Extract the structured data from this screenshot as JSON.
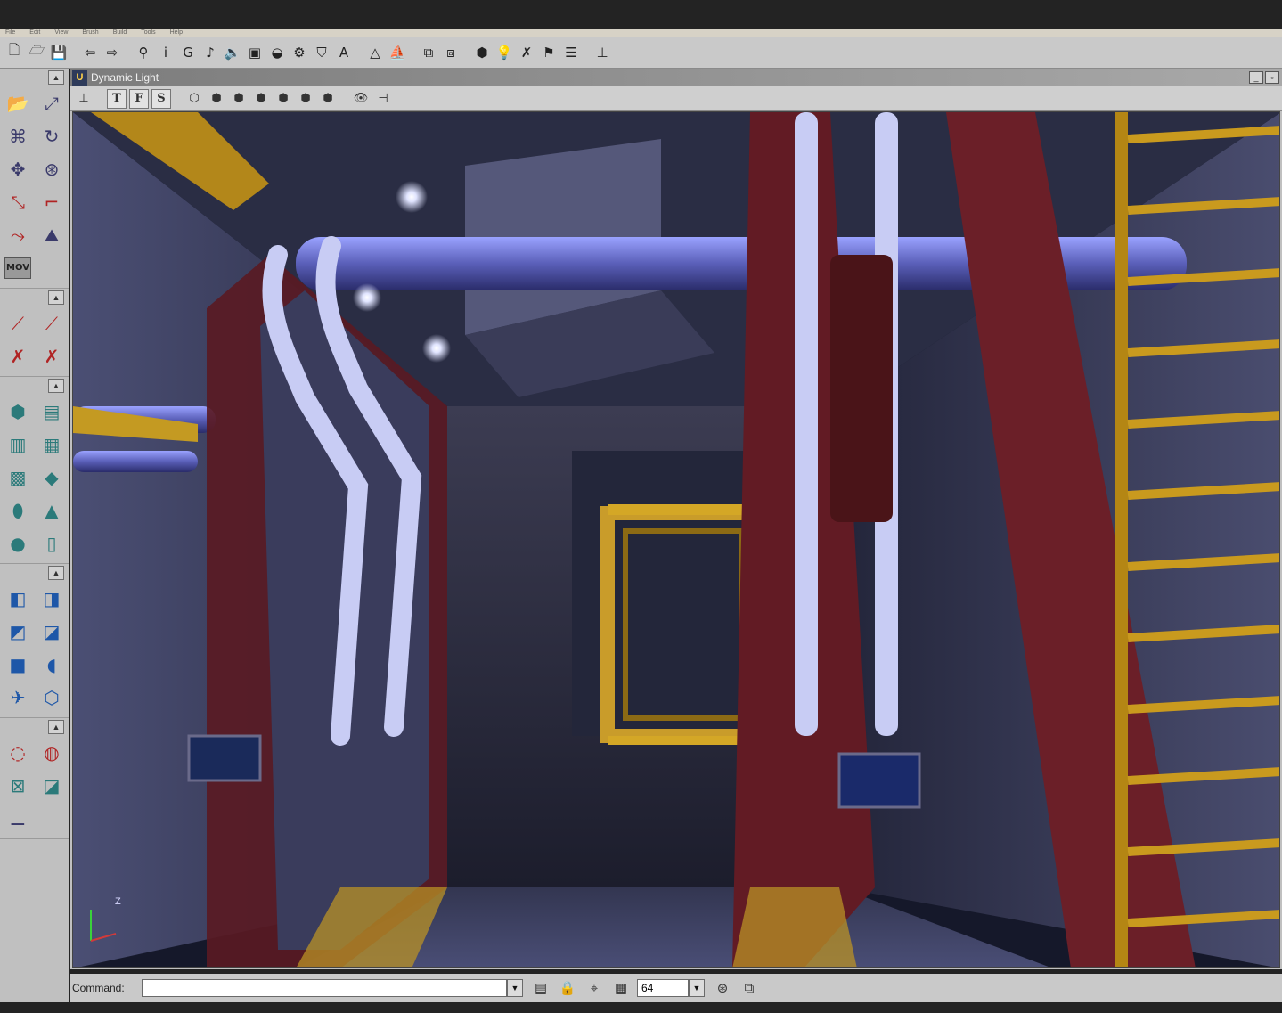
{
  "menubar": {
    "items": [
      "File",
      "Edit",
      "View",
      "Brush",
      "Build",
      "Tools",
      "Help"
    ]
  },
  "main_toolbar": {
    "buttons": [
      {
        "name": "new-map-button",
        "icon": "new-file-icon",
        "glyph": "🗋"
      },
      {
        "name": "open-map-button",
        "icon": "open-folder-icon",
        "glyph": "🗁"
      },
      {
        "name": "save-map-button",
        "icon": "save-icon",
        "glyph": "💾"
      },
      {
        "name": "undo-button",
        "icon": "undo-arrow-icon",
        "glyph": "⇦"
      },
      {
        "name": "redo-button",
        "icon": "redo-arrow-icon",
        "glyph": "⇨"
      },
      {
        "name": "search-actors-button",
        "icon": "binoculars-icon",
        "glyph": "⚲"
      },
      {
        "name": "actor-browser-button",
        "icon": "actor-class-icon",
        "glyph": "ⅰ"
      },
      {
        "name": "group-browser-button",
        "icon": "group-icon",
        "glyph": "G"
      },
      {
        "name": "music-browser-button",
        "icon": "music-note-icon",
        "glyph": "♪"
      },
      {
        "name": "sound-browser-button",
        "icon": "speaker-icon",
        "glyph": "🔈"
      },
      {
        "name": "texture-browser-button",
        "icon": "texture-icon",
        "glyph": "▣"
      },
      {
        "name": "mesh-browser-button",
        "icon": "mesh-icon",
        "glyph": "◒"
      },
      {
        "name": "animation-browser-button",
        "icon": "animation-icon",
        "glyph": "⚙"
      },
      {
        "name": "prefab-browser-button",
        "icon": "prefab-icon",
        "glyph": "⛉"
      },
      {
        "name": "font-browser-button",
        "icon": "font-icon",
        "glyph": "A"
      },
      {
        "name": "terrain-editor-button",
        "icon": "terrain-icon",
        "glyph": "△"
      },
      {
        "name": "matinee-button",
        "icon": "matinee-icon",
        "glyph": "⛵"
      },
      {
        "name": "2d-shape-editor-button",
        "icon": "shape-editor-icon",
        "glyph": "⧉"
      },
      {
        "name": "scripts-button",
        "icon": "scripts-icon",
        "glyph": "⧈"
      },
      {
        "name": "build-geometry-button",
        "icon": "build-geometry-icon",
        "glyph": "⬢"
      },
      {
        "name": "build-lighting-button",
        "icon": "lightbulb-icon",
        "glyph": "💡"
      },
      {
        "name": "build-paths-button",
        "icon": "paths-icon",
        "glyph": "✗"
      },
      {
        "name": "build-all-button",
        "icon": "build-all-icon",
        "glyph": "⚑"
      },
      {
        "name": "build-options-button",
        "icon": "sliders-icon",
        "glyph": "☰"
      },
      {
        "name": "play-map-button",
        "icon": "joystick-icon",
        "glyph": "⊥"
      }
    ]
  },
  "left_panel": {
    "groups": [
      {
        "buttons": [
          {
            "name": "camera-move-button",
            "icon": "camera-move-icon",
            "glyph": "📂",
            "tone": "blue"
          },
          {
            "name": "vertex-edit-button",
            "icon": "vertex-edit-icon",
            "glyph": "⤢",
            "tone": ""
          },
          {
            "name": "brush-clip-button",
            "icon": "brush-clip-icon",
            "glyph": "⌘",
            "tone": ""
          },
          {
            "name": "rotate-button",
            "icon": "rotate-icon",
            "glyph": "↻",
            "tone": ""
          },
          {
            "name": "scale-button",
            "icon": "scale-icon",
            "glyph": "✥",
            "tone": ""
          },
          {
            "name": "texture-pan-button",
            "icon": "texture-pan-icon",
            "glyph": "⊛",
            "tone": ""
          },
          {
            "name": "face-drag-button",
            "icon": "face-drag-icon",
            "glyph": "⤡",
            "tone": "red"
          },
          {
            "name": "freehand-polygon-button",
            "icon": "polygon-icon",
            "glyph": "⌐",
            "tone": "red"
          },
          {
            "name": "stretch-button",
            "icon": "stretch-icon",
            "glyph": "⤳",
            "tone": "red"
          },
          {
            "name": "terrain-edit-button",
            "icon": "terrain-mound-icon",
            "glyph": "⛰",
            "tone": ""
          },
          {
            "name": "matinee-mode-button",
            "icon": "matinee-clapper-icon",
            "glyph": "MOV",
            "tone": "mov"
          }
        ]
      },
      {
        "buttons": [
          {
            "name": "clip-segment-button",
            "icon": "clip-line-icon",
            "glyph": "⟋",
            "tone": "red"
          },
          {
            "name": "clip-split-button",
            "icon": "clip-split-icon",
            "glyph": "⟋",
            "tone": "red"
          },
          {
            "name": "clip-flip-button",
            "icon": "clip-flip-icon",
            "glyph": "✗",
            "tone": "red"
          },
          {
            "name": "clip-delete-button",
            "icon": "clip-delete-icon",
            "glyph": "✗",
            "tone": "red"
          }
        ]
      },
      {
        "buttons": [
          {
            "name": "cube-builder-button",
            "icon": "cube-icon",
            "glyph": "⬢",
            "tone": "teal"
          },
          {
            "name": "staircase-builder-button",
            "icon": "staircase-icon",
            "glyph": "▤",
            "tone": "teal"
          },
          {
            "name": "curved-stair-builder-button",
            "icon": "curved-stair-icon",
            "glyph": "▥",
            "tone": "teal"
          },
          {
            "name": "spiral-stair-builder-button",
            "icon": "spiral-stair-icon",
            "glyph": "▦",
            "tone": "teal"
          },
          {
            "name": "terrain-builder-button",
            "icon": "terrain-grid-icon",
            "glyph": "▩",
            "tone": "teal"
          },
          {
            "name": "sheet-builder-button",
            "icon": "sheet-icon",
            "glyph": "◆",
            "tone": "teal"
          },
          {
            "name": "cylinder-builder-button",
            "icon": "cylinder-icon",
            "glyph": "⬮",
            "tone": "teal"
          },
          {
            "name": "cone-builder-button",
            "icon": "cone-icon",
            "glyph": "▲",
            "tone": "teal"
          },
          {
            "name": "sphere-builder-button",
            "icon": "sphere-icon",
            "glyph": "●",
            "tone": "teal"
          },
          {
            "name": "volumetric-builder-button",
            "icon": "volumetric-icon",
            "glyph": "▯",
            "tone": "teal"
          }
        ]
      },
      {
        "buttons": [
          {
            "name": "csg-add-button",
            "icon": "csg-add-icon",
            "glyph": "◧",
            "tone": "blue"
          },
          {
            "name": "csg-subtract-button",
            "icon": "csg-subtract-icon",
            "glyph": "◨",
            "tone": "blue"
          },
          {
            "name": "csg-intersect-button",
            "icon": "csg-intersect-icon",
            "glyph": "◩",
            "tone": "blue"
          },
          {
            "name": "csg-deintersect-button",
            "icon": "csg-deintersect-icon",
            "glyph": "◪",
            "tone": "blue"
          },
          {
            "name": "add-mover-button",
            "icon": "mover-icon",
            "glyph": "■",
            "tone": "blue"
          },
          {
            "name": "add-special-button",
            "icon": "special-brush-icon",
            "glyph": "◖",
            "tone": "blue"
          },
          {
            "name": "add-static-mesh-button",
            "icon": "static-mesh-icon",
            "glyph": "✈",
            "tone": "blue"
          },
          {
            "name": "add-volume-button",
            "icon": "volume-icon",
            "glyph": "⬡",
            "tone": "blue"
          }
        ]
      },
      {
        "buttons": [
          {
            "name": "show-selected-button",
            "icon": "show-selected-icon",
            "glyph": "◌",
            "tone": "red"
          },
          {
            "name": "hide-selected-button",
            "icon": "hide-selected-icon",
            "glyph": "◍",
            "tone": "red"
          },
          {
            "name": "select-inverse-button",
            "icon": "select-inverse-icon",
            "glyph": "⊠",
            "tone": "teal"
          },
          {
            "name": "show-all-button",
            "icon": "show-all-icon",
            "glyph": "◪",
            "tone": "teal"
          },
          {
            "name": "camera-speed-button",
            "icon": "camera-speed-icon",
            "glyph": "⚊",
            "tone": ""
          }
        ]
      }
    ]
  },
  "viewport": {
    "title": "Dynamic Light",
    "app_icon_text": "U",
    "window_controls": [
      "_",
      "▫"
    ],
    "toolbar": {
      "realtime_icon": "⊥",
      "view_buttons": [
        "T",
        "F",
        "S"
      ],
      "render_mode_glyphs": [
        "⬡",
        "⬢",
        "⬢",
        "⬢",
        "⬢",
        "⬢",
        "⬢"
      ],
      "extra_glyphs": [
        "👁",
        "⊣"
      ]
    },
    "axis_label": "Z"
  },
  "statusbar": {
    "command_label": "Command:",
    "command_value": "",
    "grid_size": "64"
  }
}
